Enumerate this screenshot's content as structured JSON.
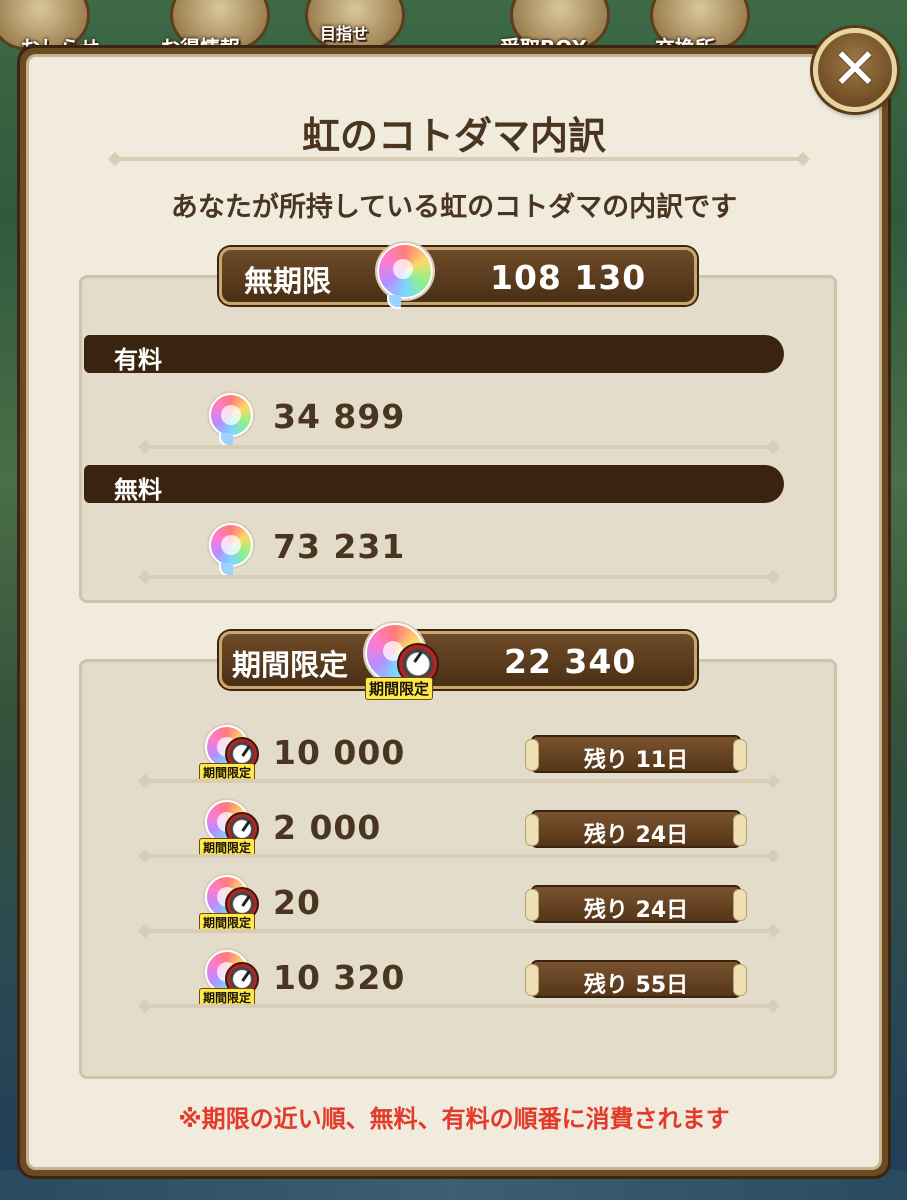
{
  "background_nav": {
    "labels": [
      "おしらせ",
      "お得情報",
      "目指せ",
      "受取BOX",
      "交換所"
    ]
  },
  "dialog": {
    "close_label": "✕",
    "title": "虹のコトダマ内訳",
    "subtitle": "あなたが所持している虹のコトダマの内訳です"
  },
  "unlimited": {
    "header_label": "無期限",
    "total": "108 130",
    "sections": [
      {
        "label": "有料",
        "amount": "34 899"
      },
      {
        "label": "無料",
        "amount": "73 231"
      }
    ]
  },
  "limited": {
    "header_label": "期間限定",
    "total": "22 340",
    "icon_tag": "期間限定",
    "items": [
      {
        "amount": "10 000",
        "remaining": "残り 11日",
        "tag": "期間限定"
      },
      {
        "amount": "2 000",
        "remaining": "残り 24日",
        "tag": "期間限定"
      },
      {
        "amount": "20",
        "remaining": "残り 24日",
        "tag": "期間限定"
      },
      {
        "amount": "10 320",
        "remaining": "残り 55日",
        "tag": "期間限定"
      }
    ]
  },
  "note": "※期限の近い順、無料、有料の順番に消費されます",
  "colors": {
    "dialog_bg": "#f1ebde",
    "frame": "#6b4a24",
    "text_brown": "#4a3520",
    "note_red": "#e33a2a"
  }
}
